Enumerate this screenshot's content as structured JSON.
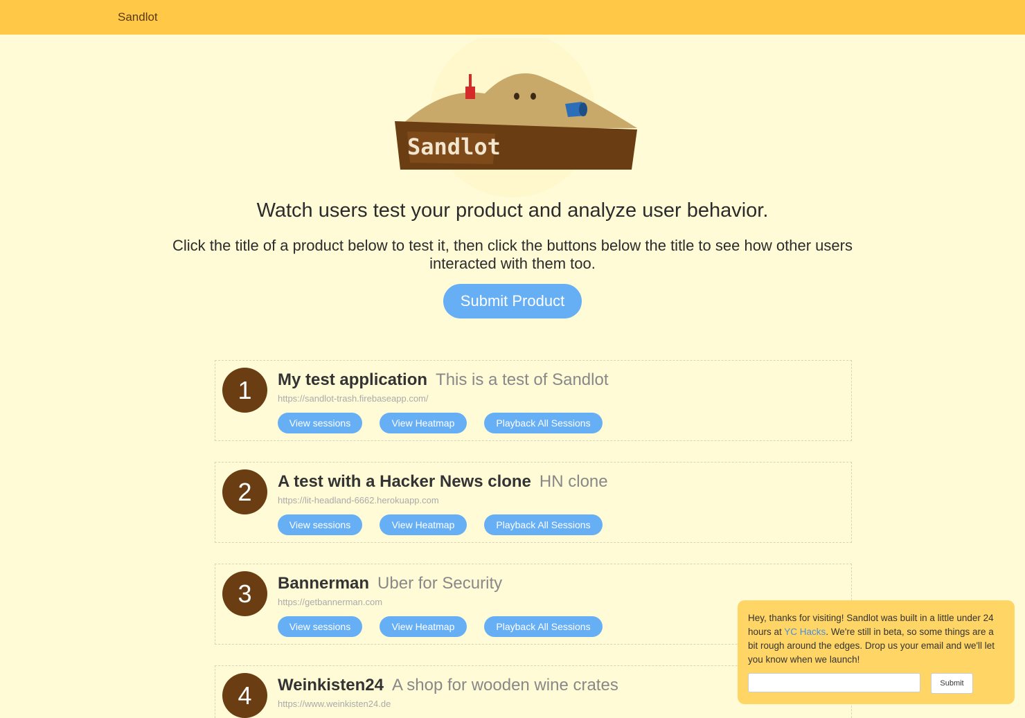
{
  "nav": {
    "brand": "Sandlot"
  },
  "hero": {
    "logo_text": "Sandlot"
  },
  "headline": "Watch users test your product and analyze user behavior.",
  "subline": "Click the title of a product below to test it, then click the buttons below the title to see how other users interacted with them too.",
  "submit_product_label": "Submit Product",
  "buttons": {
    "view_sessions": "View sessions",
    "view_heatmap": "View Heatmap",
    "playback_all": "Playback All Sessions"
  },
  "products": [
    {
      "rank": "1",
      "name": "My test application",
      "tagline": "This is a test of Sandlot",
      "url": "https://sandlot-trash.firebaseapp.com/"
    },
    {
      "rank": "2",
      "name": "A test with a Hacker News clone",
      "tagline": "HN clone",
      "url": "https://lit-headland-6662.herokuapp.com"
    },
    {
      "rank": "3",
      "name": "Bannerman",
      "tagline": "Uber for Security",
      "url": "https://getbannerman.com"
    },
    {
      "rank": "4",
      "name": "Weinkisten24",
      "tagline": "A shop for wooden wine crates",
      "url": "https://www.weinkisten24.de"
    }
  ],
  "notice": {
    "text_before": "Hey, thanks for visiting! Sandlot was built in a little under 24 hours at ",
    "link": "YC Hacks",
    "text_after": ". We're still in beta, so some things are a bit rough around the edges. Drop us your email and we'll let you know when we launch!",
    "email_value": "",
    "submit_label": "Submit"
  },
  "colors": {
    "topbar": "#ffc847",
    "background": "#fffbd6",
    "accent": "#66aff5",
    "rank_badge": "#6b3d12",
    "notice": "#ffd566"
  }
}
